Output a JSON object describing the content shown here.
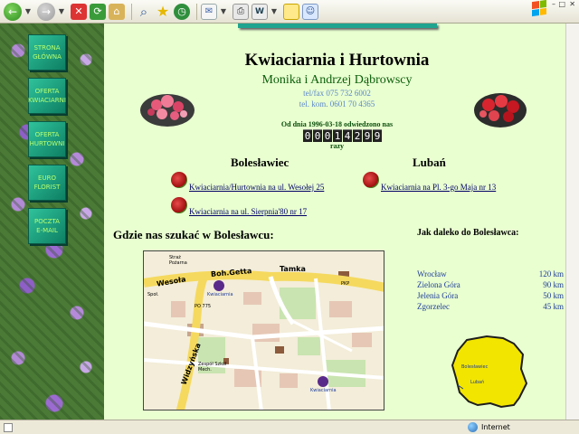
{
  "browser": {
    "toolbar": {
      "back": "←",
      "forward": "→",
      "stop": "✕",
      "refresh": "⟳",
      "home": "⌂",
      "search": "⌕",
      "favorites": "★",
      "history": "◷",
      "mail": "✉",
      "print": "⎙",
      "word": "W",
      "messenger": "☺"
    },
    "window_controls": {
      "min": "–",
      "restore": "□",
      "close": "✕"
    },
    "status_zone": "Internet"
  },
  "sidebar": {
    "items": [
      {
        "label": "STRONA GŁÓWNA"
      },
      {
        "label": "OFERTA KWIACIARNI"
      },
      {
        "label": "OFERTA HURTOWNI"
      },
      {
        "label": "EURO FLORIST"
      },
      {
        "label": "POCZTA E-MAIL"
      }
    ]
  },
  "page": {
    "title": "Kwiaciarnia i Hurtownia",
    "owners": "Monika i Andrzej Dąbrowscy",
    "phone_fax": "tel/fax 075 732 6002",
    "phone_mobile": "tel. kom. 0601 70 4365",
    "since": "Od dnia 1996-03-18 odwiedzono nas",
    "counter": [
      "0",
      "0",
      "0",
      "1",
      "4",
      "2",
      "9",
      "9"
    ],
    "times": "razy",
    "cities": {
      "boleslawiec": {
        "name": "Bolesławiec",
        "links": [
          "Kwiaciarnia/Hurtownia na ul. Wesołej 25",
          "Kwiaciarnia na ul. Sierpnia'80 nr 17"
        ]
      },
      "luban": {
        "name": "Lubań",
        "links": [
          "Kwiaciarnia na Pl. 3-go Maja nr 13"
        ]
      }
    },
    "where_heading": "Gdzie nas szukać w Bolesławcu:",
    "distance_heading": "Jak daleko do Bolesławca:",
    "distances": [
      {
        "city": "Wrocław",
        "km": "120 km"
      },
      {
        "city": "Zielona Góra",
        "km": "90 km"
      },
      {
        "city": "Jelenia Góra",
        "km": "50 km"
      },
      {
        "city": "Zgorzelec",
        "km": "45 km"
      }
    ],
    "map_labels": {
      "street1": "Boh.Getta",
      "street2": "Tamka",
      "street3": "Wesoła",
      "street4": "Widzyńska",
      "area1": "Straż Pożarna",
      "area2": "Zespół Szkół Mech.",
      "area3": "Społ.",
      "area4": "PKP",
      "area5": "PO 775",
      "shop1": "Kwiaciarnia",
      "shop2": "Kwiaciarnia"
    },
    "poland_labels": {
      "boleslawiec": "Bolesławiec",
      "luban": "Lubań"
    }
  },
  "colors": {
    "page_bg": "#e9ffd0",
    "nav_button": "#1fa884",
    "nav_text": "#b6ff70",
    "link": "#000066",
    "distance_text": "#1e3c9a",
    "owners": "#0a5e0a",
    "poland": "#f2e500"
  }
}
